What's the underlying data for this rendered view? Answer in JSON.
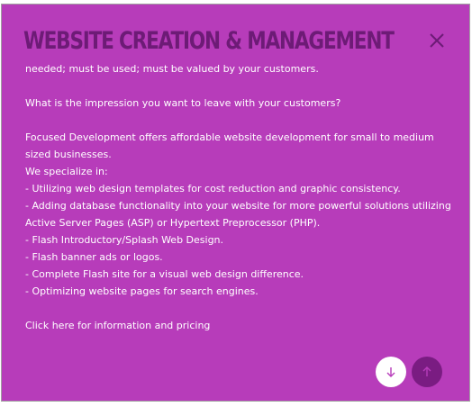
{
  "modal": {
    "title": "WEBSITE CREATION & MANAGEMENT",
    "close_icon": "close-x-icon"
  },
  "content": {
    "partial_line": "needed; must be used; must be valued by your customers.",
    "question": "What is the impression you want to leave with your customers?",
    "intro": "Focused Development offers affordable website development for small to medium sized businesses.",
    "specialize": "We specialize in:",
    "items": [
      "- Utilizing web design templates for cost reduction and graphic consistency.",
      "- Adding database functionality into your website for more powerful solutions utilizing Active Server Pages (ASP) or Hypertext Preprocessor (PHP).",
      "- Flash Introductory/Splash Web Design.",
      "- Flash banner ads or logos.",
      "- Complete Flash site for a visual web design difference.",
      "- Optimizing website pages for search engines."
    ],
    "link": "Click here for information and pricing"
  },
  "controls": {
    "scroll_down_icon": "arrow-down-icon",
    "scroll_up_icon": "arrow-up-icon"
  },
  "colors": {
    "background": "#b73cba",
    "title": "#6d1b76",
    "text": "#ffffff",
    "up_button": "#7a1c82"
  }
}
